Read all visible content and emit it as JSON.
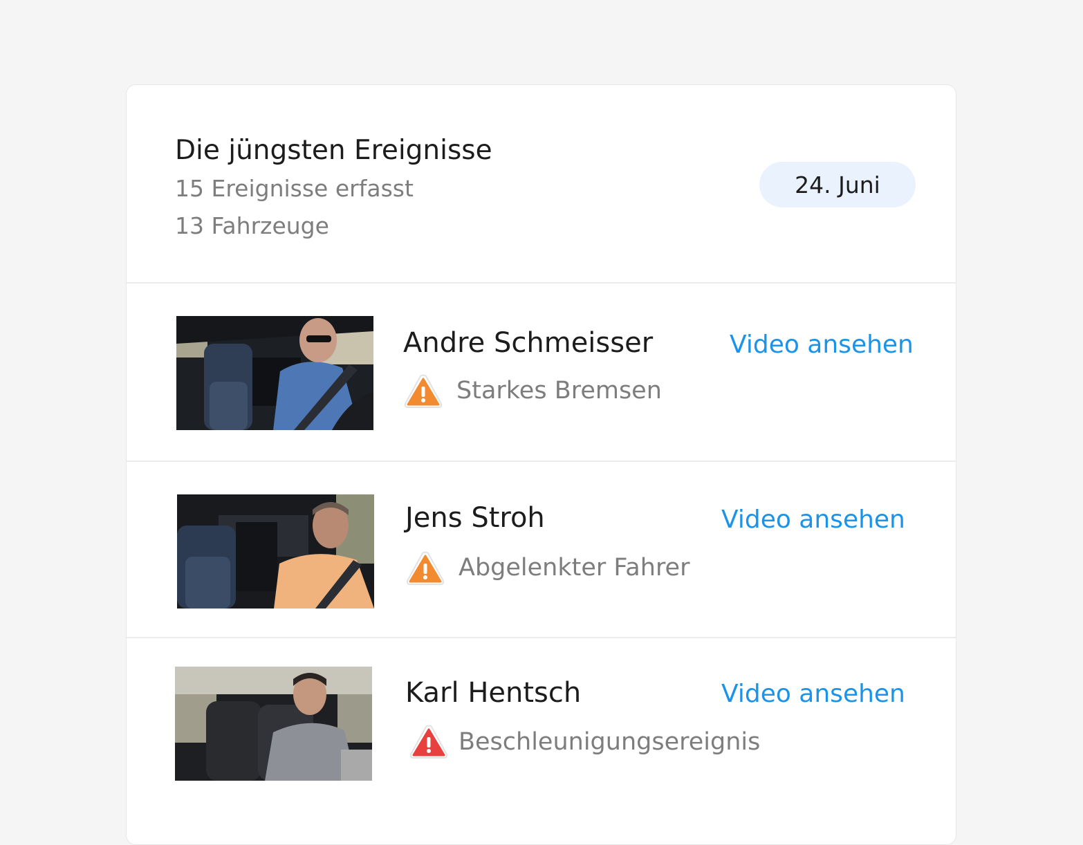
{
  "panel": {
    "title": "Die jüngsten Ereignisse",
    "events_count": "15 Ereignisse erfasst",
    "vehicles_count": "13 Fahrzeuge",
    "date": "24. Juni"
  },
  "events": [
    {
      "driver": "Andre Schmeisser",
      "type": "Starkes Bremsen",
      "link": "Video ansehen",
      "icon": "warning-icon",
      "severity_color": "#f28a30"
    },
    {
      "driver": "Jens Stroh",
      "type": "Abgelenkter Fahrer",
      "link": "Video ansehen",
      "icon": "warning-icon",
      "severity_color": "#f28a30"
    },
    {
      "driver": "Karl Hentsch",
      "type": "Beschleunigungsereignis",
      "link": "Video ansehen",
      "icon": "warning-icon",
      "severity_color": "#e8403f"
    }
  ],
  "colors": {
    "link": "#1a93e8",
    "pill_bg": "#eaf3fd",
    "warning_orange": "#f28a30",
    "warning_red": "#e8403f"
  }
}
